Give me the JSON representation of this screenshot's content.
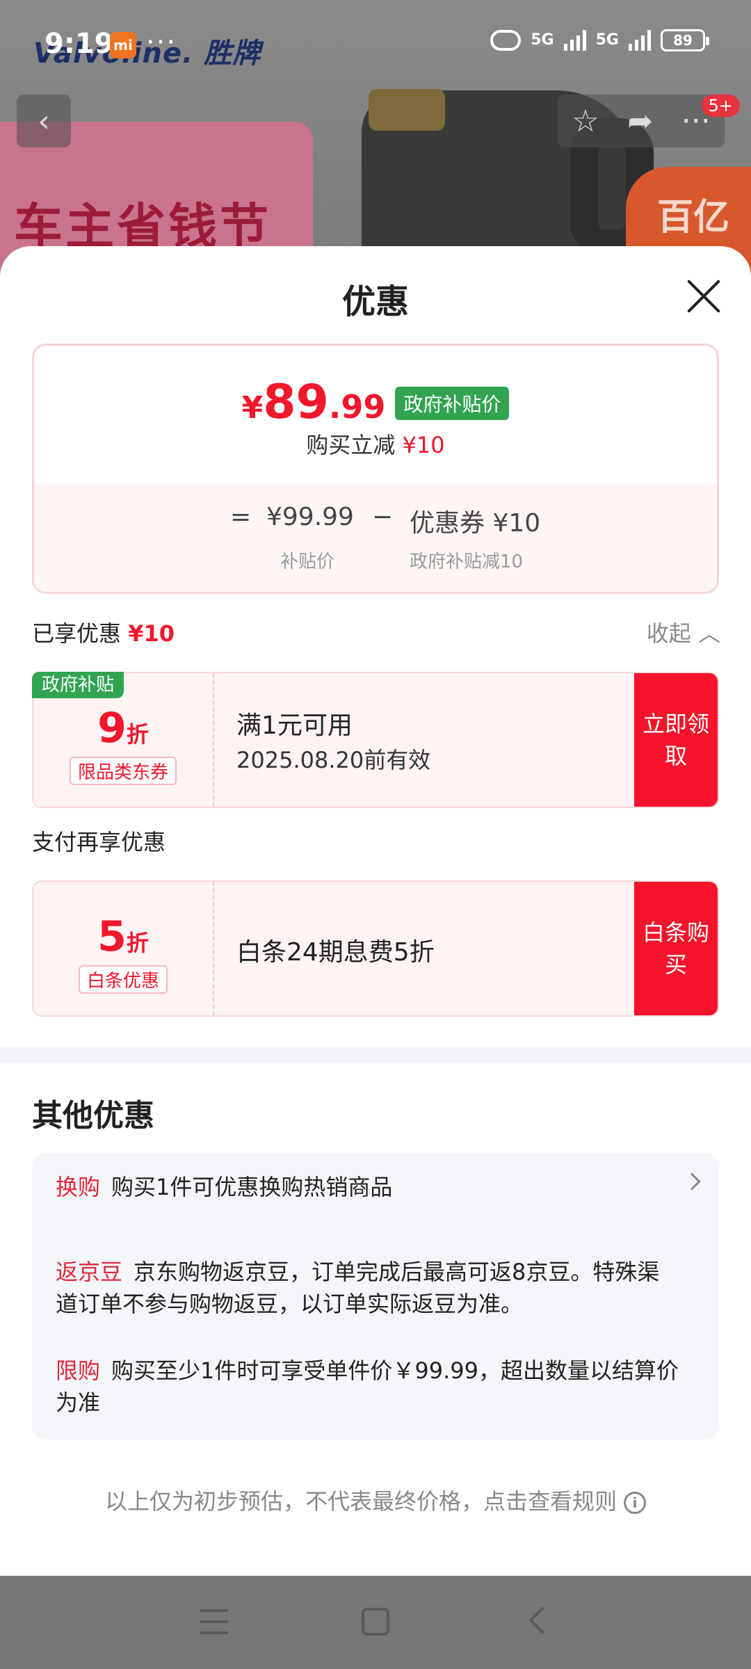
{
  "status_bar": {
    "time": "9:19",
    "mi_badge": "mi",
    "more": "···",
    "signal1": "5G",
    "signal2": "5G",
    "battery": "89"
  },
  "background": {
    "brand": "Valvoline. 胜牌",
    "poster_text": "车主省钱节",
    "tag_text": "百亿补贴",
    "badge": "5+"
  },
  "sheet": {
    "title": "优惠",
    "price": {
      "currency": "¥",
      "integer": "89",
      "decimal": ".99",
      "tag": "政府补贴价",
      "subtitle_prefix": "购买立减",
      "subtitle_amount": "¥10"
    },
    "calc": {
      "equals": "=",
      "base_price": "¥99.99",
      "minus": "−",
      "coupon": "优惠券 ¥10",
      "base_label": "补贴价",
      "coupon_label": "政府补贴减10"
    },
    "enjoyed": {
      "label": "已享优惠",
      "amount": "¥10",
      "collapse": "收起"
    },
    "coupon1": {
      "flag": "政府补贴",
      "discount": "9",
      "unit": "折",
      "kind": "限品类东券",
      "line1": "满1元可用",
      "line2": "2025.08.20前有效",
      "cta": "立即领取"
    },
    "pay_title": "支付再享优惠",
    "coupon2": {
      "discount": "5",
      "unit": "折",
      "kind": "白条优惠",
      "line": "白条24期息费5折",
      "cta": "白条购买"
    },
    "other": {
      "title": "其他优惠",
      "items": [
        {
          "tag": "换购",
          "text": "购买1件可优惠换购热销商品"
        },
        {
          "tag": "返京豆",
          "text": "京东购物返京豆，订单完成后最高可返8京豆。特殊渠道订单不参与购物返豆，以订单实际返豆为准。"
        },
        {
          "tag": "限购",
          "text": "购买至少1件时可享受单件价￥99.99，超出数量以结算价为准"
        }
      ]
    },
    "footer": "以上仅为初步预估，不代表最终价格，点击查看规则"
  },
  "colors": {
    "accent_red": "#f2172b",
    "gov_green": "#32a451"
  }
}
